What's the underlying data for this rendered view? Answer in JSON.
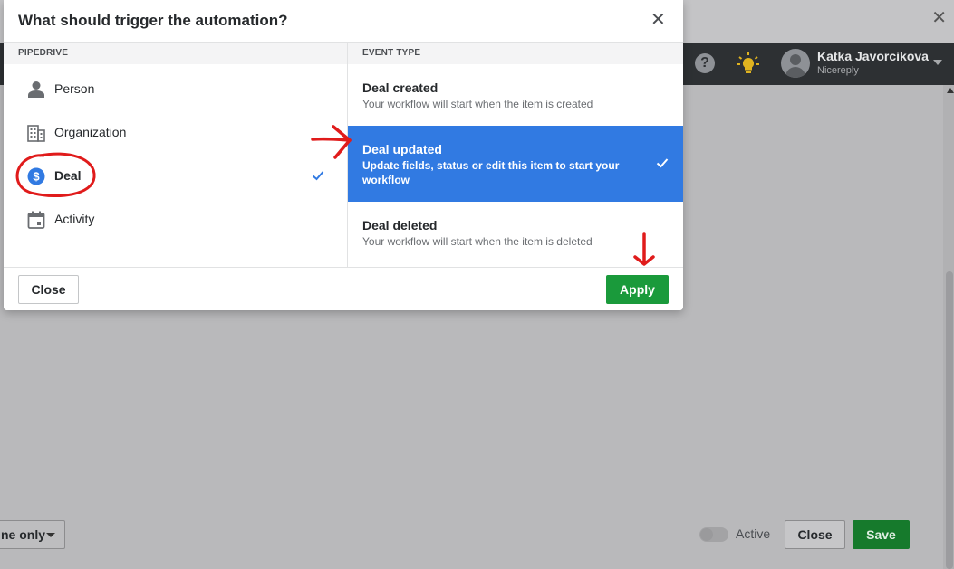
{
  "modal": {
    "title": "What should trigger the automation?",
    "apps_header": "PIPEDRIVE",
    "events_header": "EVENT TYPE",
    "apps": [
      {
        "label": "Person",
        "icon": "person-icon"
      },
      {
        "label": "Organization",
        "icon": "building-icon"
      },
      {
        "label": "Deal",
        "icon": "dollar-icon",
        "selected": true
      },
      {
        "label": "Activity",
        "icon": "calendar-icon"
      }
    ],
    "events": [
      {
        "title": "Deal created",
        "description": "Your workflow will start when the item is created"
      },
      {
        "title": "Deal updated",
        "description": "Update fields, status or edit this item to start your workflow",
        "selected": true
      },
      {
        "title": "Deal deleted",
        "description": "Your workflow will start when the item is deleted"
      }
    ],
    "close_label": "Close",
    "apply_label": "Apply"
  },
  "header": {
    "user_name": "Katka Javorcikova",
    "user_company": "Nicereply",
    "help_icon_glyph": "?"
  },
  "footer": {
    "dropdown_label": "ne only",
    "toggle_label": "Active",
    "close_label": "Close",
    "save_label": "Save"
  },
  "colors": {
    "selected_event": "#317ae2",
    "apply_button": "#1a9a3b",
    "deal_icon": "#317ae2",
    "annotation": "#e01b1b"
  }
}
